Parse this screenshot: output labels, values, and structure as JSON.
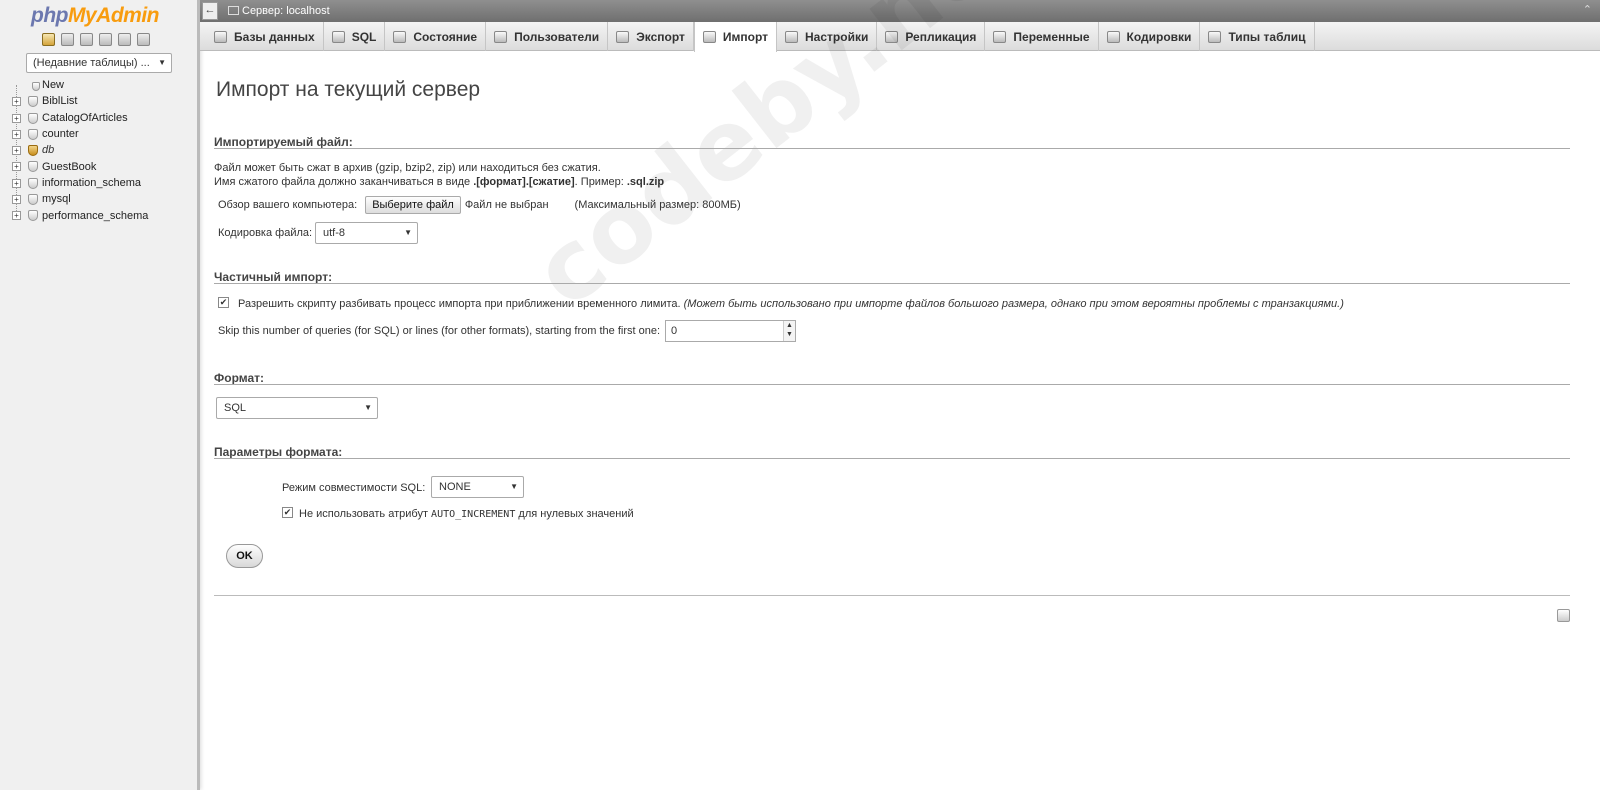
{
  "sidebar": {
    "logo": {
      "php": "php",
      "my": "My",
      "admin": "Admin"
    },
    "recent_tables": "(Недавние таблицы) ...",
    "new_label": "New",
    "databases": [
      {
        "name": "BiblList",
        "italic": false
      },
      {
        "name": "CatalogOfArticles",
        "italic": false
      },
      {
        "name": "counter",
        "italic": false
      },
      {
        "name": "db",
        "italic": true
      },
      {
        "name": "GuestBook",
        "italic": false
      },
      {
        "name": "information_schema",
        "italic": false
      },
      {
        "name": "mysql",
        "italic": false
      },
      {
        "name": "performance_schema",
        "italic": false
      }
    ]
  },
  "topbar": {
    "back": "←",
    "server": "Сервер: localhost",
    "collapse": "⌃"
  },
  "tabs": [
    {
      "label": "Базы данных"
    },
    {
      "label": "SQL"
    },
    {
      "label": "Состояние"
    },
    {
      "label": "Пользователи"
    },
    {
      "label": "Экспорт"
    },
    {
      "label": "Импорт",
      "active": true
    },
    {
      "label": "Настройки"
    },
    {
      "label": "Репликация"
    },
    {
      "label": "Переменные"
    },
    {
      "label": "Кодировки"
    },
    {
      "label": "Типы таблиц"
    }
  ],
  "main": {
    "title": "Импорт на текущий сервер",
    "file_section": {
      "title": "Импортируемый файл:",
      "desc1": "Файл может быть сжат в архив (gzip, bzip2, zip) или находиться без сжатия.",
      "desc2_prefix": "Имя сжатого файла должно заканчиваться в виде ",
      "desc2_format": ".[формат].[сжатие]",
      "desc2_mid": ". Пример: ",
      "desc2_example": ".sql.zip",
      "browse_label": "Обзор вашего компьютера:",
      "choose_button": "Выберите файл",
      "no_file": "Файл не выбран",
      "max_size": "(Максимальный размер: 800МБ)",
      "charset_label": "Кодировка файла:",
      "charset_value": "utf-8"
    },
    "partial_section": {
      "title": "Частичный импорт:",
      "allow_interrupt": "Разрешить скрипту разбивать процесс импорта при приближении временного лимита.",
      "allow_interrupt_note": "(Может быть использовано при импорте файлов большого размера, однако при этом вероятны проблемы с транзакциями.)",
      "allow_interrupt_checked": true,
      "skip_label": "Skip this number of queries (for SQL) or lines (for other formats), starting from the first one:",
      "skip_value": "0"
    },
    "format_section": {
      "title": "Формат:",
      "value": "SQL"
    },
    "format_options": {
      "title": "Параметры формата:",
      "compat_label": "Режим совместимости SQL:",
      "compat_value": "NONE",
      "no_auto_inc_prefix": "Не использовать атрибут ",
      "no_auto_inc_code": "AUTO_INCREMENT",
      "no_auto_inc_suffix": " для нулевых значений",
      "no_auto_inc_checked": true
    },
    "ok_button": "OK",
    "watermark": "codeby.net"
  }
}
